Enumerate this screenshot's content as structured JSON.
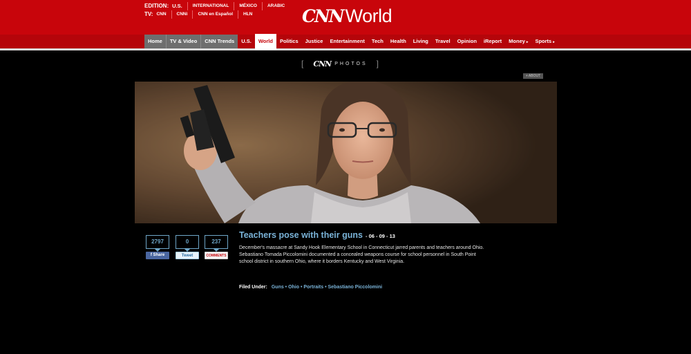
{
  "editions": {
    "edition_label": "EDITION:",
    "edition_current": "U.S.",
    "edition_options": [
      "INTERNATIONAL",
      "MÉXICO",
      "ARABIC"
    ],
    "tv_label": "TV:",
    "tv_options": [
      "CNN",
      "CNNi",
      "CNN en Español",
      "HLN"
    ]
  },
  "brand": {
    "logo": "CNN",
    "section": "World"
  },
  "nav": [
    "Home",
    "TV & Video",
    "CNN Trends",
    "U.S.",
    "World",
    "Politics",
    "Justice",
    "Entertainment",
    "Tech",
    "Health",
    "Living",
    "Travel",
    "Opinion",
    "iReport",
    "Money",
    "Sports"
  ],
  "nav_active": "World",
  "photos_label": {
    "open": "[",
    "logo": "CNN",
    "text": "PHOTOS",
    "close": "]"
  },
  "about_label": "+ ABOUT",
  "social": {
    "facebook": {
      "count": "2797",
      "label": "f  Share"
    },
    "twitter": {
      "count": "0",
      "label": "Tweet"
    },
    "comments": {
      "count": "237",
      "label": "COMMENTS"
    }
  },
  "article": {
    "title": "Teachers pose with their guns",
    "date": "- 06 - 09 - 13",
    "description": "December's massacre at Sandy Hook Elementary School in Connecticut jarred parents and teachers around Ohio. Sebastiano Tomada Piccolomini documented a concealed weapons course for school personnel in South Point school district in southern Ohio, where it borders Kentucky and West Virginia.",
    "filed_label": "Filed Under:",
    "tags": "Guns • Ohio • Portraits • Sebastiano Piccolomini"
  },
  "colors": {
    "header_red": "#c8050b",
    "link_blue": "#7ab3d8",
    "background": "#000000"
  }
}
